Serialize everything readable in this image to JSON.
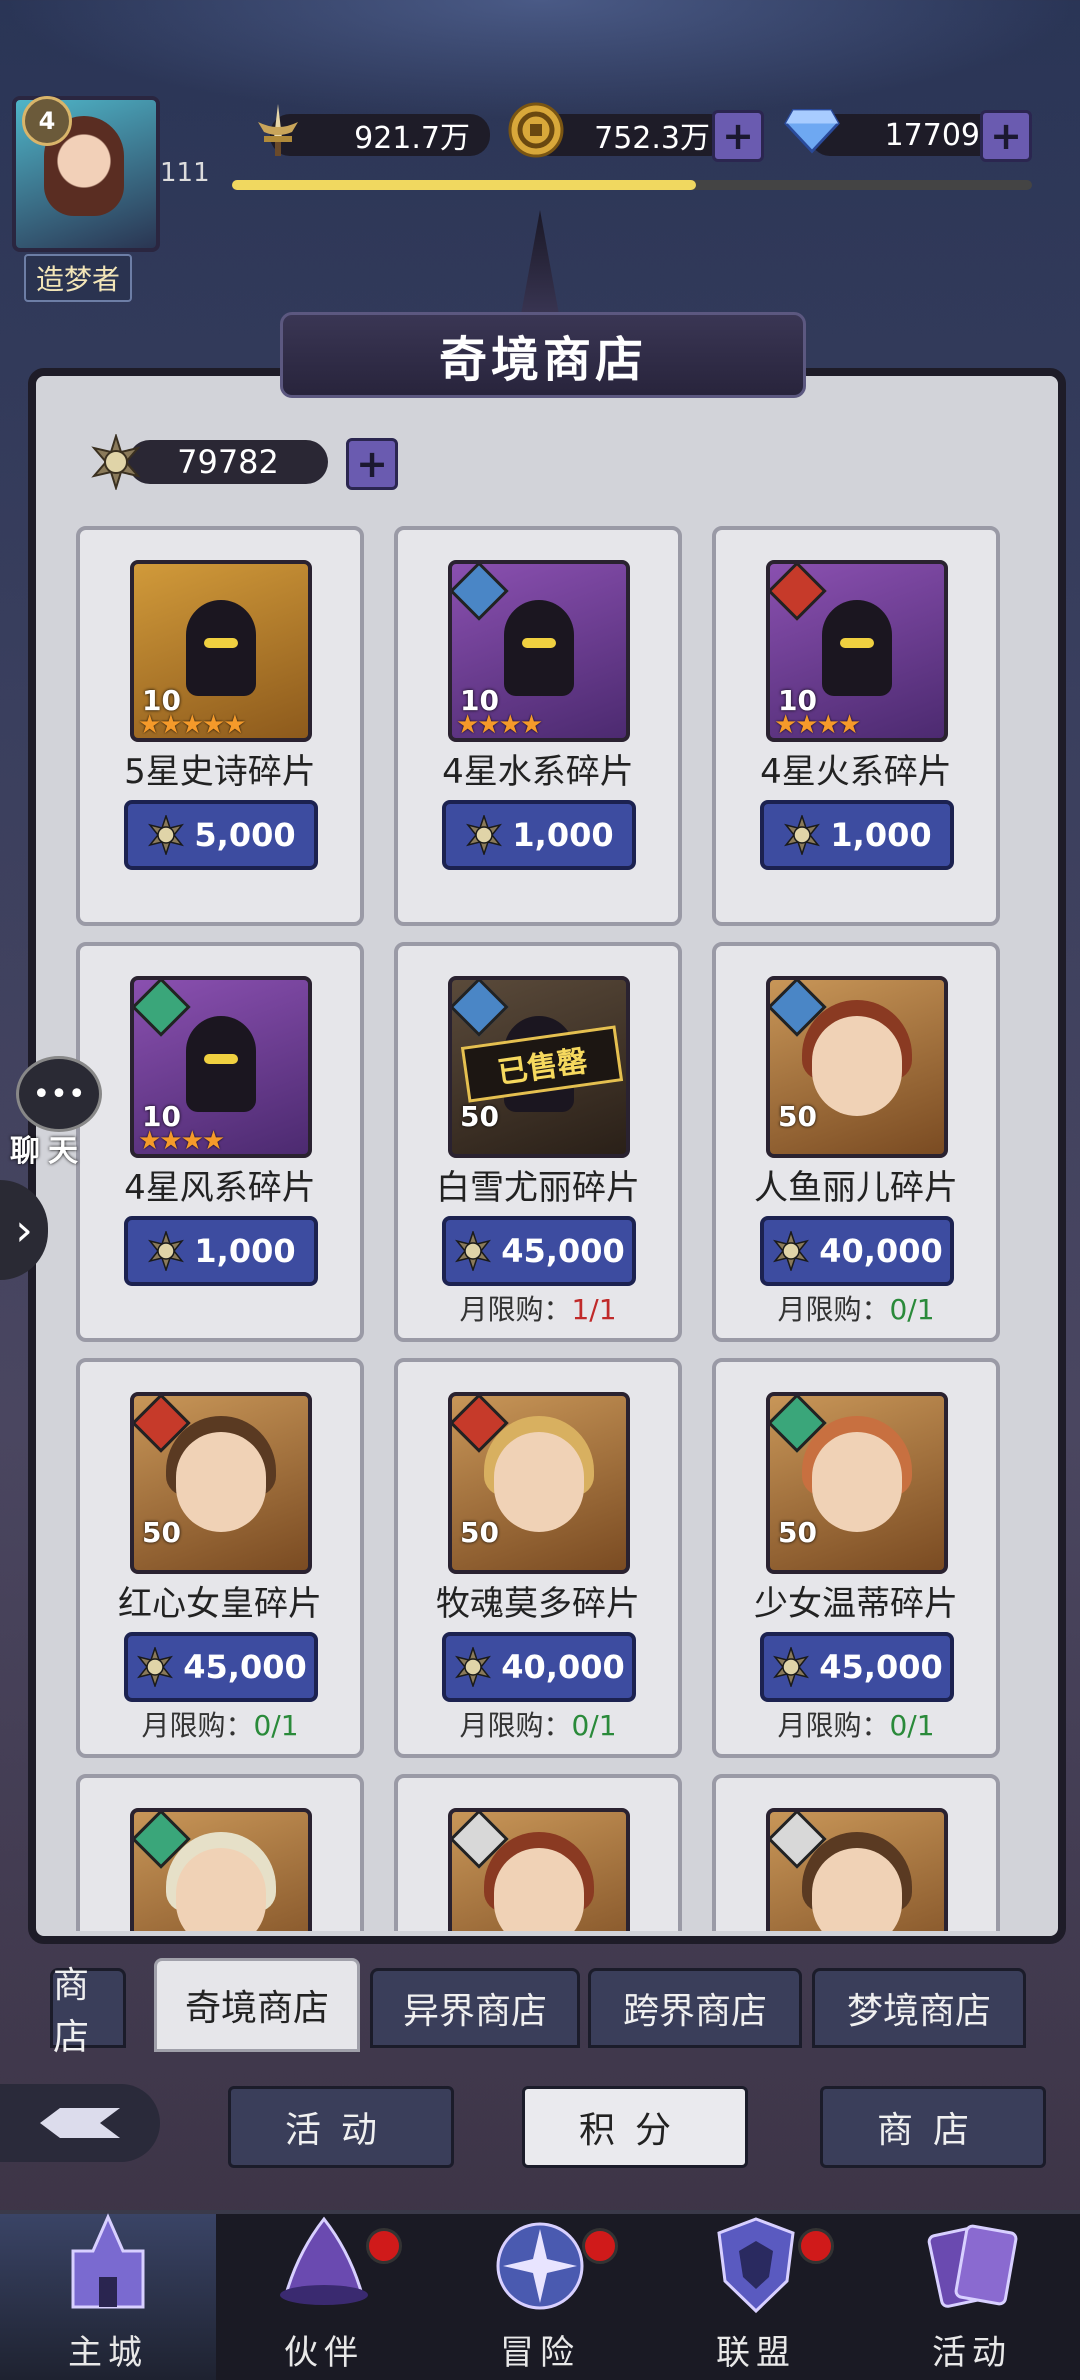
{
  "player": {
    "level": "4",
    "number": "111",
    "title": "造梦者",
    "exp_fraction": 0.58
  },
  "resources": {
    "power": "921.7万",
    "gold": "752.3万",
    "diamonds": "17709"
  },
  "shop": {
    "title": "奇境商店",
    "currency_amount": "79782",
    "items": [
      {
        "name": "5星史诗碎片",
        "price": "5,000",
        "qty": "10",
        "stars": "★★★★★",
        "thumb": "gold",
        "art": "hood",
        "element": "",
        "limit_label": "",
        "limit_value": "",
        "limit_color": ""
      },
      {
        "name": "4星水系碎片",
        "price": "1,000",
        "qty": "10",
        "stars": "★★★★",
        "thumb": "purple",
        "art": "hood",
        "element": "water",
        "limit_label": "",
        "limit_value": "",
        "limit_color": ""
      },
      {
        "name": "4星火系碎片",
        "price": "1,000",
        "qty": "10",
        "stars": "★★★★",
        "thumb": "purple",
        "art": "hood",
        "element": "fire",
        "limit_label": "",
        "limit_value": "",
        "limit_color": ""
      },
      {
        "name": "4星风系碎片",
        "price": "1,000",
        "qty": "10",
        "stars": "★★★★",
        "thumb": "purple",
        "art": "hood",
        "element": "wind",
        "limit_label": "",
        "limit_value": "",
        "limit_color": ""
      },
      {
        "name": "白雪尤丽碎片",
        "price": "45,000",
        "qty": "50",
        "stars": "",
        "thumb": "dark",
        "art": "sold",
        "element": "water",
        "sold_text": "已售罄",
        "limit_label": "月限购：",
        "limit_value": "1/1",
        "limit_color": "red"
      },
      {
        "name": "人鱼丽儿碎片",
        "price": "40,000",
        "qty": "50",
        "stars": "",
        "thumb": "brown",
        "art": "face",
        "element": "water",
        "limit_label": "月限购：",
        "limit_value": "0/1",
        "limit_color": "green"
      },
      {
        "name": "红心女皇碎片",
        "price": "45,000",
        "qty": "50",
        "stars": "",
        "thumb": "brown",
        "art": "face",
        "element": "fire",
        "limit_label": "月限购：",
        "limit_value": "0/1",
        "limit_color": "green"
      },
      {
        "name": "牧魂莫多碎片",
        "price": "40,000",
        "qty": "50",
        "stars": "",
        "thumb": "brown",
        "art": "face",
        "element": "fire",
        "limit_label": "月限购：",
        "limit_value": "0/1",
        "limit_color": "green"
      },
      {
        "name": "少女温蒂碎片",
        "price": "45,000",
        "qty": "50",
        "stars": "",
        "thumb": "brown",
        "art": "face",
        "element": "wind",
        "limit_label": "月限购：",
        "limit_value": "0/1",
        "limit_color": "green"
      },
      {
        "name": "",
        "price": "",
        "qty": "",
        "stars": "",
        "thumb": "brown",
        "art": "face",
        "element": "wind",
        "limit_label": "",
        "limit_value": "",
        "limit_color": ""
      },
      {
        "name": "",
        "price": "",
        "qty": "",
        "stars": "",
        "thumb": "brown",
        "art": "face",
        "element": "light",
        "limit_label": "",
        "limit_value": "",
        "limit_color": ""
      },
      {
        "name": "",
        "price": "",
        "qty": "",
        "stars": "",
        "thumb": "brown",
        "art": "face",
        "element": "light",
        "limit_label": "",
        "limit_value": "",
        "limit_color": ""
      }
    ]
  },
  "tabs": [
    {
      "label": "商店",
      "active": false
    },
    {
      "label": "奇境商店",
      "active": true
    },
    {
      "label": "异界商店",
      "active": false
    },
    {
      "label": "跨界商店",
      "active": false
    },
    {
      "label": "梦境商店",
      "active": false
    }
  ],
  "subnav": [
    {
      "label": "活动",
      "active": false
    },
    {
      "label": "积分",
      "active": true
    },
    {
      "label": "商店",
      "active": false
    }
  ],
  "chat": {
    "label": "聊天"
  },
  "bottom_nav": [
    {
      "label": "主城",
      "active": true,
      "dot": false,
      "icon": "castle-icon"
    },
    {
      "label": "伙伴",
      "active": false,
      "dot": true,
      "icon": "wizard-hat-icon"
    },
    {
      "label": "冒险",
      "active": false,
      "dot": true,
      "icon": "compass-icon"
    },
    {
      "label": "联盟",
      "active": false,
      "dot": true,
      "icon": "shield-icon"
    },
    {
      "label": "活动",
      "active": false,
      "dot": false,
      "icon": "cards-icon"
    }
  ],
  "colors": {
    "price_button": "#3d4ca0",
    "plus_button": "#6a5bb0",
    "exp_bar": "#f0d860",
    "limit_red": "#c02a2a",
    "limit_green": "#2a8a3a"
  }
}
